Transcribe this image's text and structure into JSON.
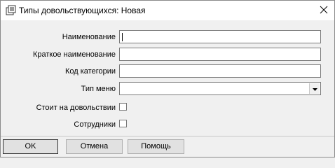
{
  "window": {
    "title": "Типы довольствующихся: Новая"
  },
  "form": {
    "name_label": "Наименование",
    "short_name_label": "Краткое наименование",
    "category_code_label": "Код категории",
    "menu_type_label": "Тип меню",
    "on_allowance_label": "Стоит на довольствии",
    "employees_label": "Сотрудники",
    "name_value": "",
    "short_name_value": "",
    "category_code_value": "",
    "menu_type_value": "",
    "on_allowance_checked": false,
    "employees_checked": false
  },
  "buttons": {
    "ok_label": "OK",
    "cancel_label": "Отмена",
    "help_label": "Помощь"
  },
  "icons": {
    "window": "form-window-icon",
    "close": "close-icon",
    "dropdown": "dropdown-arrow-icon"
  }
}
